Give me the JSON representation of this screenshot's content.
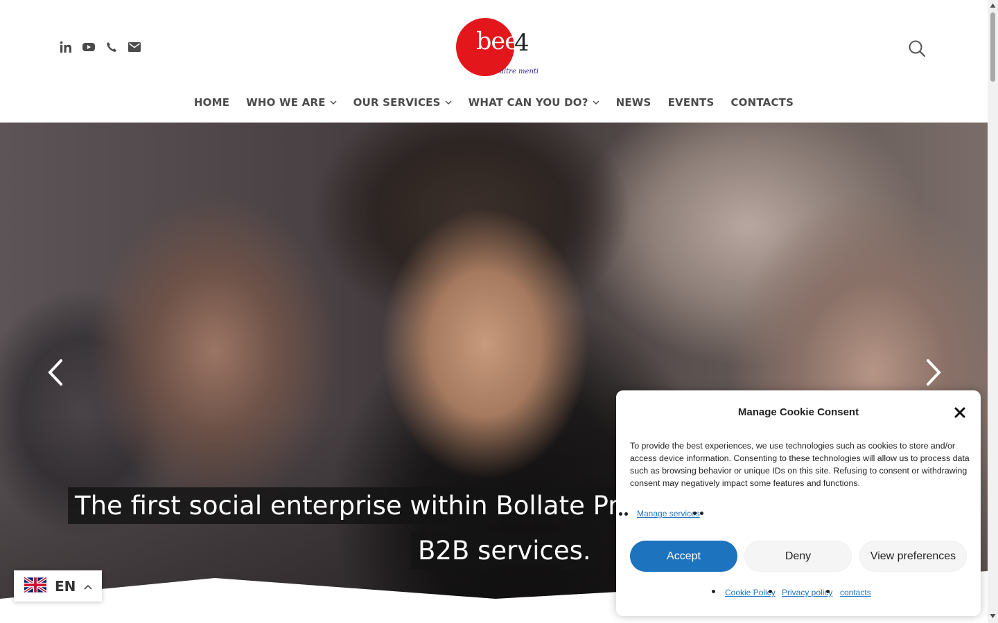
{
  "header": {
    "logo": {
      "brand": "bee",
      "number": "4",
      "tagline": "altre menti"
    },
    "social_icons": [
      "linkedin-icon",
      "youtube-icon",
      "phone-icon",
      "email-icon"
    ]
  },
  "nav": {
    "items": [
      {
        "label": "HOME",
        "dropdown": false
      },
      {
        "label": "WHO WE ARE",
        "dropdown": true
      },
      {
        "label": "OUR SERVICES",
        "dropdown": true
      },
      {
        "label": "WHAT CAN YOU DO?",
        "dropdown": true
      },
      {
        "label": "NEWS",
        "dropdown": false
      },
      {
        "label": "EVENTS",
        "dropdown": false
      },
      {
        "label": "CONTACTS",
        "dropdown": false
      }
    ]
  },
  "hero": {
    "caption_line1": "The first social enterprise within Bollate Pri",
    "caption_line2": "B2B services."
  },
  "language": {
    "code": "EN"
  },
  "cookie": {
    "title": "Manage Cookie Consent",
    "text": "To provide the best experiences, we use technologies such as cookies to store and/or access device information. Consenting to these technologies will allow us to process data such as browsing behavior or unique IDs on this site. Refusing to consent or withdrawing consent may negatively impact some features and functions.",
    "manage_link": "Manage services",
    "accept": "Accept",
    "deny": "Deny",
    "view_preferences": "View preferences",
    "links": [
      "Cookie Policy",
      "Privacy policy",
      "contacts"
    ]
  },
  "colors": {
    "brand_red": "#e3161c",
    "accent_blue": "#1e73be",
    "nav_text": "#4b4b4b"
  }
}
